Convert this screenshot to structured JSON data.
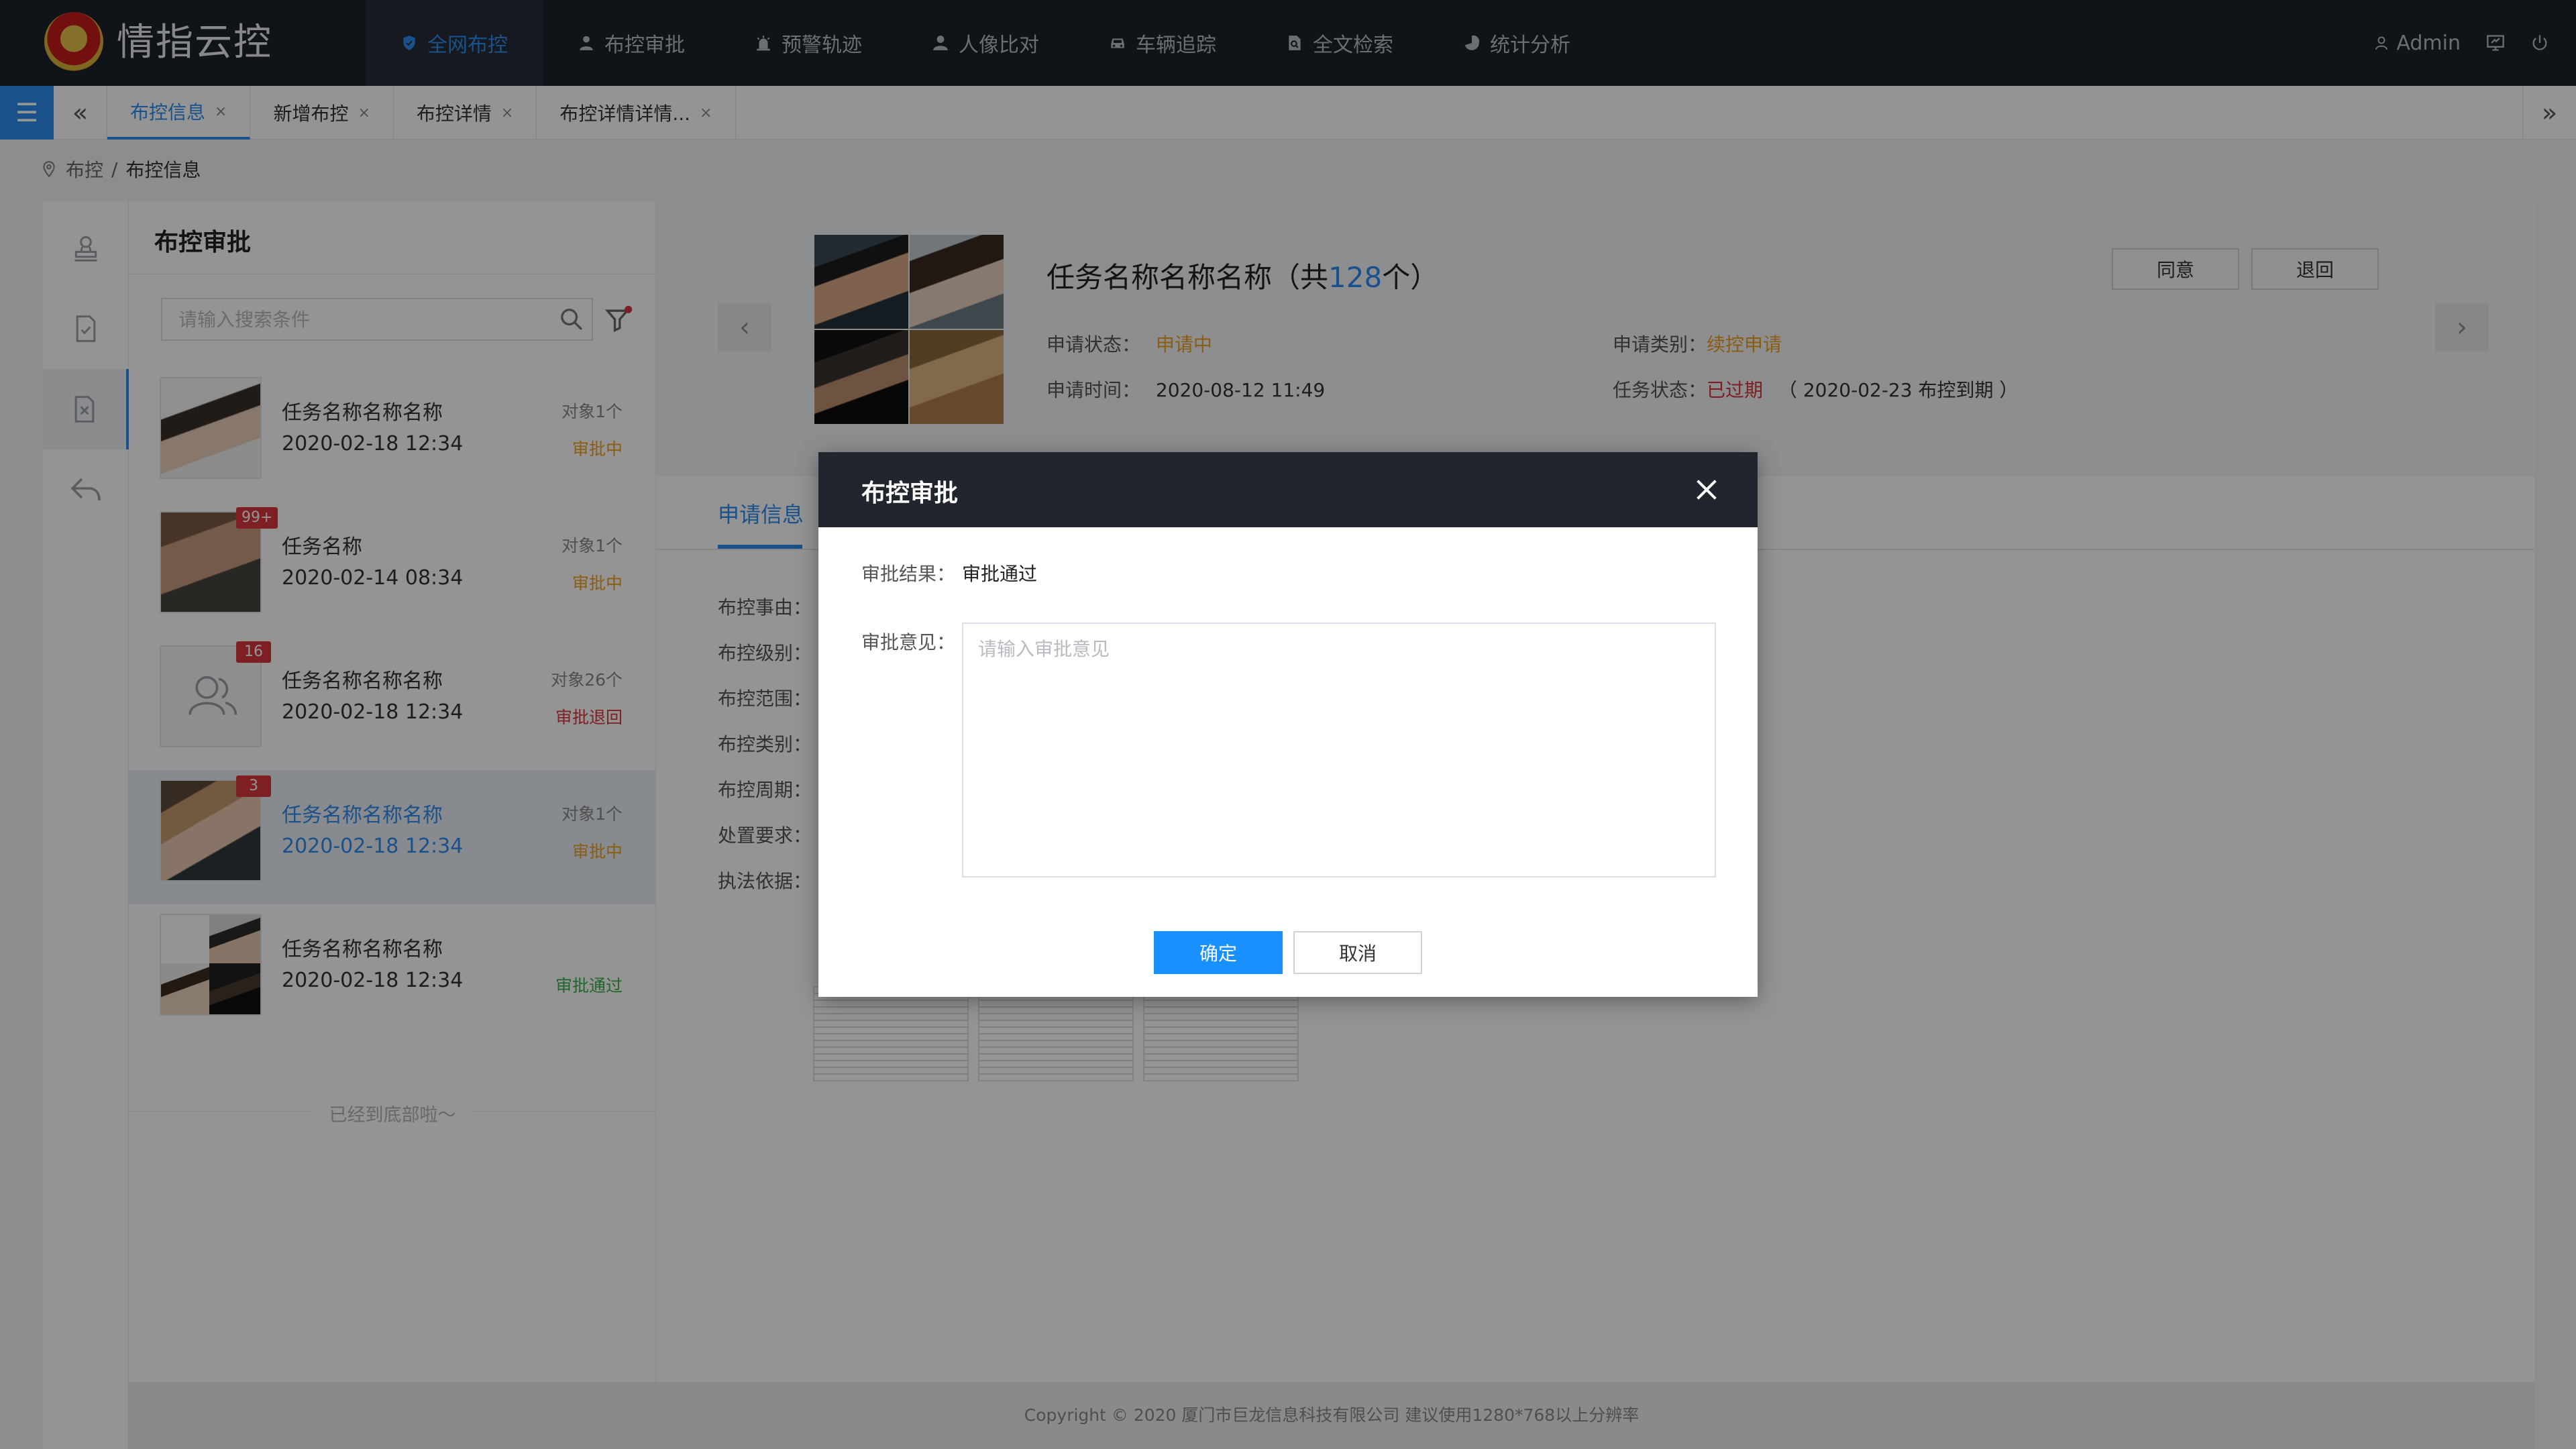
{
  "app": {
    "title": "情指云控"
  },
  "nav": {
    "items": [
      {
        "label": "全网布控",
        "icon": "shield-icon"
      },
      {
        "label": "布控审批",
        "icon": "user-icon"
      },
      {
        "label": "预警轨迹",
        "icon": "alarm-icon"
      },
      {
        "label": "人像比对",
        "icon": "person-icon"
      },
      {
        "label": "车辆追踪",
        "icon": "car-icon"
      },
      {
        "label": "全文检索",
        "icon": "document-search-icon"
      },
      {
        "label": "统计分析",
        "icon": "pie-chart-icon"
      }
    ],
    "active_index": 0,
    "user": "Admin"
  },
  "tabs": [
    {
      "label": "布控信息"
    },
    {
      "label": "新增布控"
    },
    {
      "label": "布控详情"
    },
    {
      "label": "布控详情详情..."
    }
  ],
  "breadcrumb": {
    "parent": "布控",
    "separator": "/",
    "current": "布控信息"
  },
  "list_panel": {
    "title": "布控审批",
    "search_placeholder": "请输入搜索条件",
    "items": [
      {
        "name": "任务名称名称名称",
        "date": "2020-02-18  12:34",
        "count": "对象1个",
        "status": "审批中",
        "badge": ""
      },
      {
        "name": "任务名称",
        "date": "2020-02-14  08:34",
        "count": "对象1个",
        "status": "审批中",
        "badge": "99+"
      },
      {
        "name": "任务名称名称名称",
        "date": "2020-02-18  12:34",
        "count": "对象26个",
        "status": "审批退回",
        "badge": "16"
      },
      {
        "name": "任务名称名称名称",
        "date": "2020-02-18  12:34",
        "count": "对象1个",
        "status": "审批中",
        "badge": "3"
      },
      {
        "name": "任务名称名称名称",
        "date": "2020-02-18  12:34",
        "count": "",
        "status": "审批通过",
        "badge": ""
      }
    ],
    "end_text": "已经到底部啦～"
  },
  "detail": {
    "title_prefix": "任务名称名称名称（共",
    "title_count": "128",
    "title_suffix": "个）",
    "apply_status_label": "申请状态：",
    "apply_status": "申请中",
    "apply_type_label": "申请类别：",
    "apply_type": "续控申请",
    "apply_time_label": "申请时间：",
    "apply_time": "2020-08-12   11:49",
    "task_status_label": "任务状态：",
    "task_status": "已过期",
    "task_status_note": "（ 2020-02-23  布控到期 ）",
    "agree_label": "同意",
    "return_label": "退回",
    "tab_label": "申请信息",
    "fields": [
      "布控事由：",
      "布控级别：",
      "布控范围：",
      "布控类别：",
      "布控周期：",
      "处置要求：",
      "执法依据："
    ]
  },
  "modal": {
    "title": "布控审批",
    "result_label": "审批结果：",
    "result_value": "审批通过",
    "opinion_label": "审批意见：",
    "opinion_placeholder": "请输入审批意见",
    "confirm_label": "确定",
    "cancel_label": "取消"
  },
  "footer": {
    "text": "Copyright © 2020  厦门市巨龙信息科技有限公司  建议使用1280*768以上分辨率"
  },
  "colors": {
    "accent": "#2d8cf0",
    "pending": "#f0a020",
    "rejected": "#d9363e",
    "passed": "#3ab14d",
    "topbar": "#1c2129"
  }
}
